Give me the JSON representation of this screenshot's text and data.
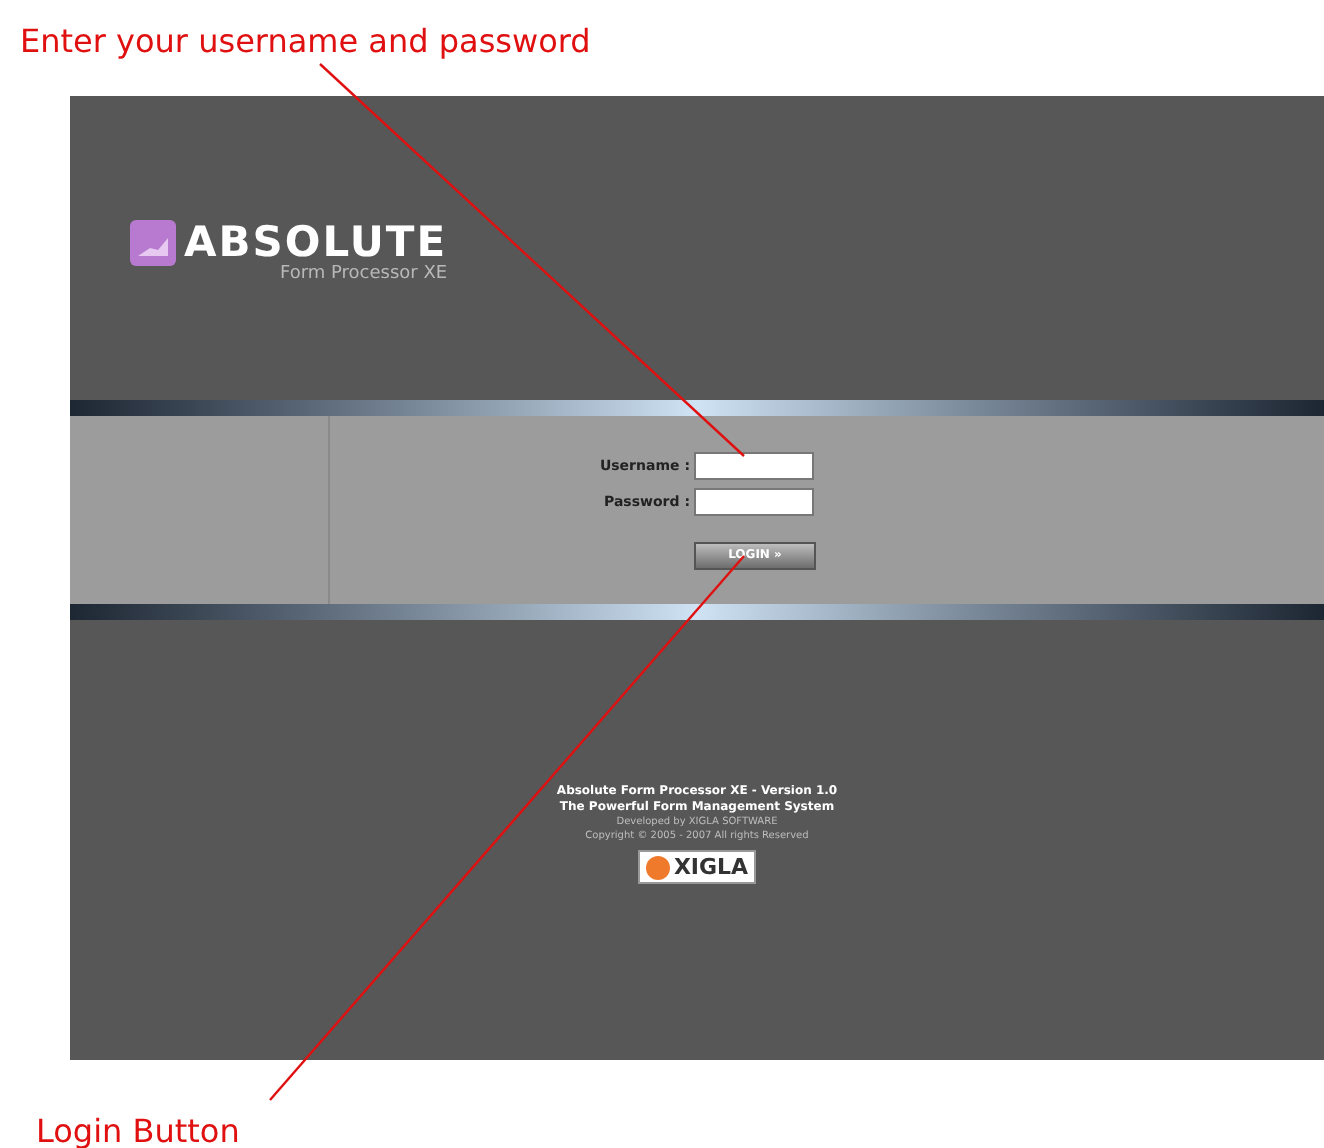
{
  "annotations": [
    {
      "text": "Enter your username and password"
    },
    {
      "text": "Login Button"
    }
  ],
  "logo": {
    "title": "ABSOLUTE",
    "subtitle": "Form Processor XE"
  },
  "login_form": {
    "fields": [
      {
        "label": "Username :"
      },
      {
        "label": "Password :"
      }
    ],
    "button": "LOGIN »"
  },
  "footer": {
    "lines": [
      "Absolute Form Processor XE - Version 1.0",
      "The Powerful Form Management System",
      "Developed by XIGLA SOFTWARE",
      "Copyright © 2005 - 2007 All rights Reserved"
    ],
    "company_logo": "XIGLA"
  }
}
